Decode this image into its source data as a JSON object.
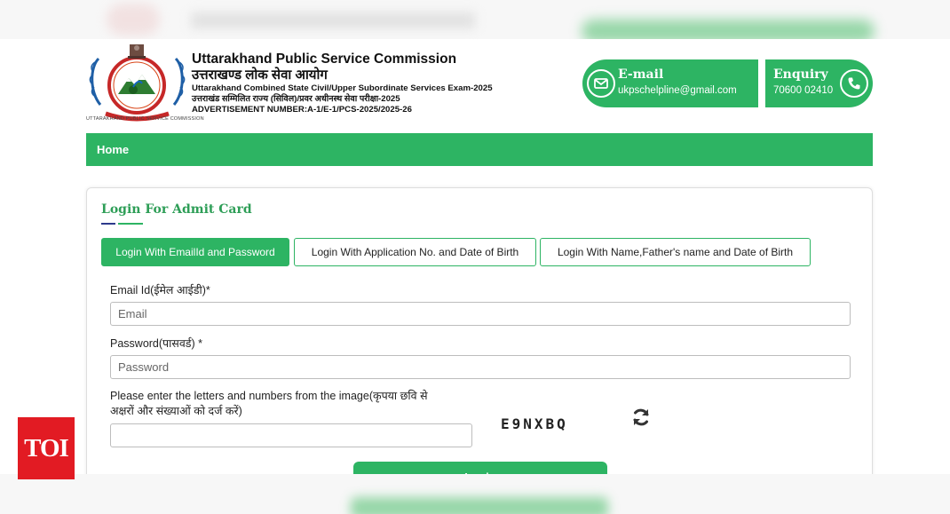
{
  "header": {
    "logo_caption": "UTTARAKHAND PUBLIC SERVICE COMMISSION",
    "title_en": "Uttarakhand Public Service Commission",
    "title_hi": "उत्तराखण्ड लोक सेवा आयोग",
    "exam_en": "Uttarakhand Combined State Civil/Upper Subordinate Services Exam-2025",
    "exam_hi": "उत्तराखंड सम्मिलित राज्य (सिविल)/प्रवर अधीनस्थ सेवा परीक्षा-2025",
    "advertisement": "ADVERTISEMENT NUMBER:A-1/E-1/PCS-2025/2025-26"
  },
  "contact": {
    "email_label": "E-mail",
    "email_value": "ukpschelpline@gmail.com",
    "enquiry_label": "Enquiry",
    "enquiry_value": "70600 02410"
  },
  "nav": {
    "home": "Home"
  },
  "login": {
    "title": "Login For Admit Card",
    "tabs": [
      {
        "label": "Login With EmailId and Password",
        "active": true
      },
      {
        "label": "Login With Application No. and Date of Birth",
        "active": false
      },
      {
        "label": "Login With Name,Father's name and Date of Birth",
        "active": false
      }
    ],
    "email_label": "Email Id(ईमेल आईडी)*",
    "email_placeholder": "Email",
    "password_label": "Password(पासवर्ड) *",
    "password_placeholder": "Password",
    "captcha_label_line1": "Please enter the letters and numbers from the image(कृपया छवि से",
    "captcha_label_line2": "अक्षरों और संख्याओं को दर्ज करें)",
    "captcha_value": "",
    "captcha_text": "E9NXBQ",
    "submit_label": "Login"
  },
  "watermark": "TOI",
  "colors": {
    "primary_green": "#2db463",
    "title_green": "#2e9e57",
    "underline_blue": "#2d3a8c",
    "toi_red": "#e21b23"
  },
  "icons": {
    "email": "envelope-icon",
    "enquiry": "phone-icon",
    "captcha_refresh": "refresh-icon"
  }
}
